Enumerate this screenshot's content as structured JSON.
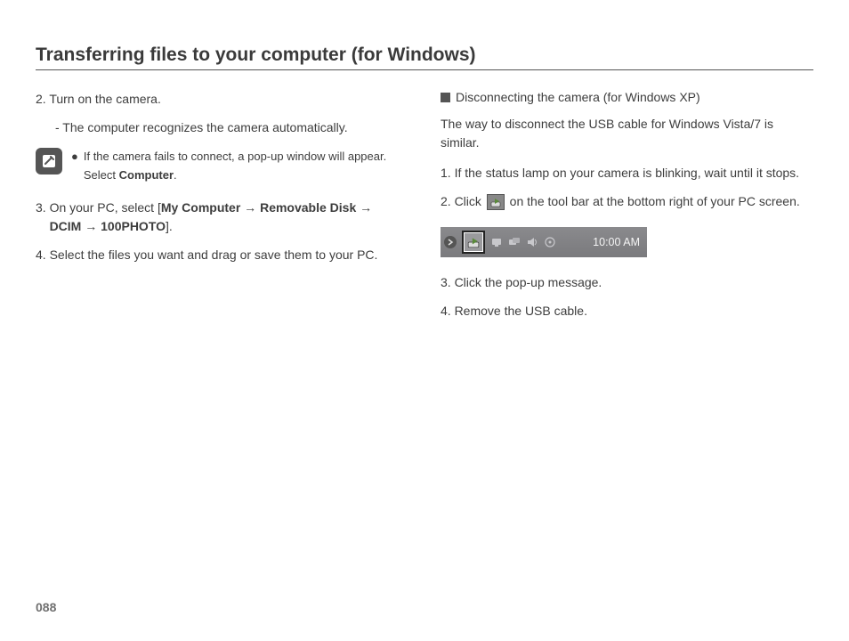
{
  "title": "Transferring files to your computer (for Windows)",
  "page_number": "088",
  "left": {
    "step2": "2. Turn on the camera.",
    "step2_sub": "- The computer recognizes the camera automatically.",
    "note_line": "If the camera fails to connect, a pop-up window will appear. Select ",
    "note_bold": "Computer",
    "note_period": ".",
    "step3_pre": "3. On your PC, select [",
    "step3_b1": "My Computer",
    "step3_arrow": " → ",
    "step3_b2": "Removable Disk",
    "step3_b3": "DCIM",
    "step3_b4": "100PHOTO",
    "step3_post": "].",
    "step4": "4. Select the files you want and drag or save them to your PC."
  },
  "right": {
    "subhead": "Disconnecting the camera (for Windows XP)",
    "intro": "The way to disconnect the USB cable for Windows Vista/7 is similar.",
    "step1": "1. If the status lamp on your camera is blinking, wait until it stops.",
    "step2_pre": "2. Click ",
    "step2_post": " on the tool bar at the bottom right of your PC screen.",
    "taskbar_time": "10:00 AM",
    "step3": "3. Click the pop-up message.",
    "step4": "4. Remove the USB cable."
  }
}
